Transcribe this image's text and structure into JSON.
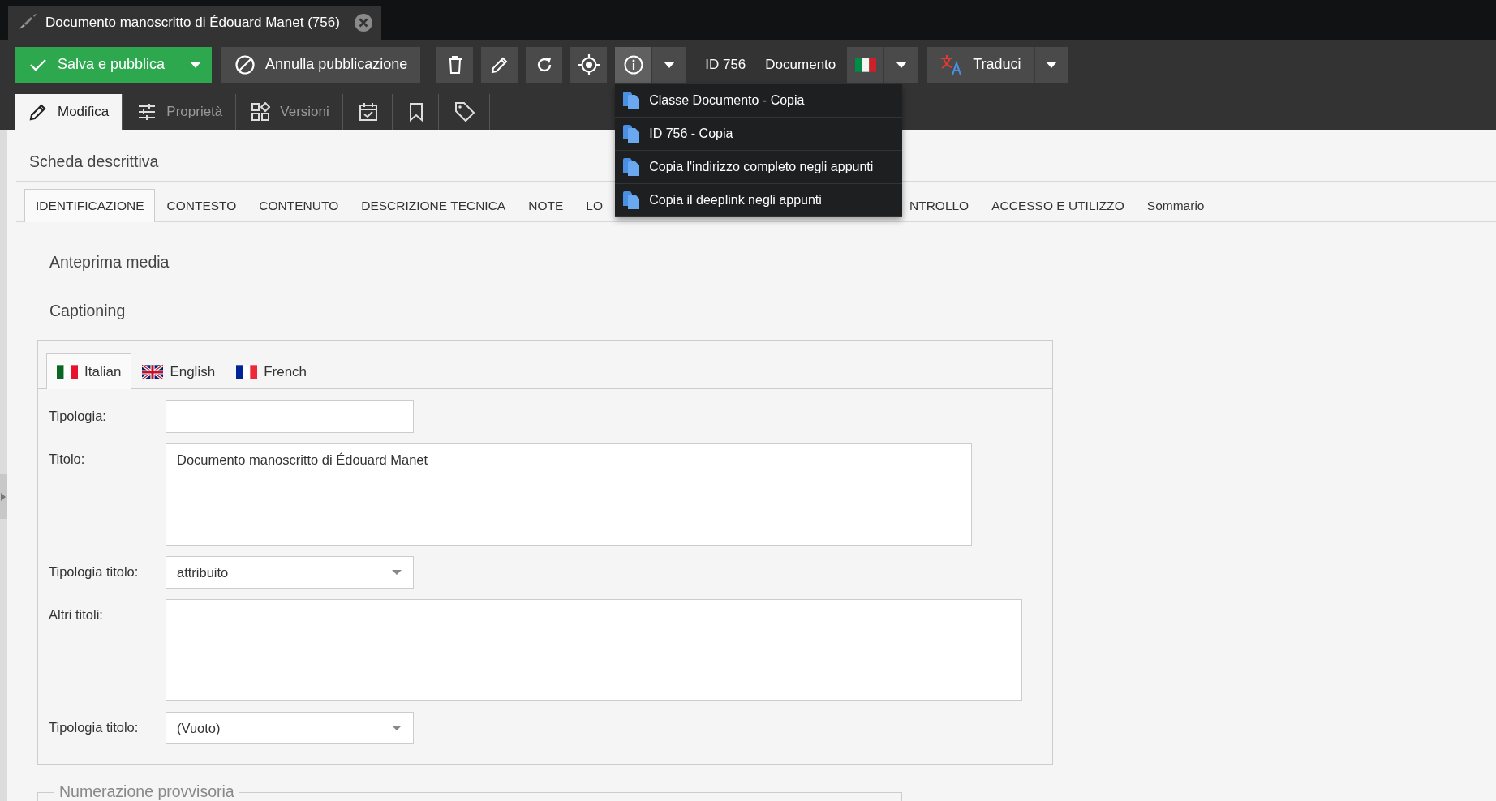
{
  "document_tab": {
    "title": "Documento manoscritto di Édouard Manet (756)"
  },
  "toolbar": {
    "save_label": "Salva e pubblica",
    "unpublish_label": "Annulla pubblicazione",
    "info_expanded": true,
    "id_label": "ID 756",
    "class_label": "Documento",
    "translate_label": "Traduci"
  },
  "info_menu": [
    {
      "label": "Classe Documento - Copia"
    },
    {
      "label": "ID 756 - Copia"
    },
    {
      "label": "Copia l'indirizzo completo negli appunti"
    },
    {
      "label": "Copia il deeplink negli appunti"
    }
  ],
  "edit_tabs": [
    {
      "label": "Modifica",
      "selected": true,
      "disabled": false
    },
    {
      "label": "Proprietà",
      "selected": false,
      "disabled": true
    },
    {
      "label": "Versioni",
      "selected": false,
      "disabled": true
    }
  ],
  "section_title": "Scheda descrittiva",
  "section_tabs": [
    {
      "label": "IDENTIFICAZIONE",
      "selected": true,
      "cut": false
    },
    {
      "label": "CONTESTO",
      "selected": false,
      "cut": false
    },
    {
      "label": "CONTENUTO",
      "selected": false,
      "cut": false
    },
    {
      "label": "DESCRIZIONE TECNICA",
      "selected": false,
      "cut": false
    },
    {
      "label": "NOTE",
      "selected": false,
      "cut": false
    },
    {
      "label": "LO",
      "selected": false,
      "cut": true
    },
    {
      "label": "NTROLLO",
      "selected": false,
      "cut": false
    },
    {
      "label": "ACCESSO E UTILIZZO",
      "selected": false,
      "cut": false
    },
    {
      "label": "Sommario",
      "selected": false,
      "cut": false
    }
  ],
  "headings": [
    "Anteprima media",
    "Captioning"
  ],
  "captioning": {
    "language_tabs": [
      {
        "label": "Italian",
        "kind": "italy",
        "selected": true
      },
      {
        "label": "English",
        "kind": "uk",
        "selected": false
      },
      {
        "label": "French",
        "kind": "france",
        "selected": false
      }
    ],
    "fields": [
      {
        "kind": "input",
        "label": "Tipologia:"
      },
      {
        "kind": "textarea",
        "label": "Titolo:",
        "value": "Documento manoscritto di Édouard Manet"
      },
      {
        "kind": "select",
        "label": "Tipologia titolo:",
        "value": "attribuito"
      },
      {
        "kind": "textarea",
        "label": "Altri titoli:"
      },
      {
        "kind": "select",
        "label": "Tipologia titolo:",
        "value": "(Vuoto)"
      }
    ]
  },
  "next_section": {
    "legend": "Numerazione provvisoria"
  }
}
